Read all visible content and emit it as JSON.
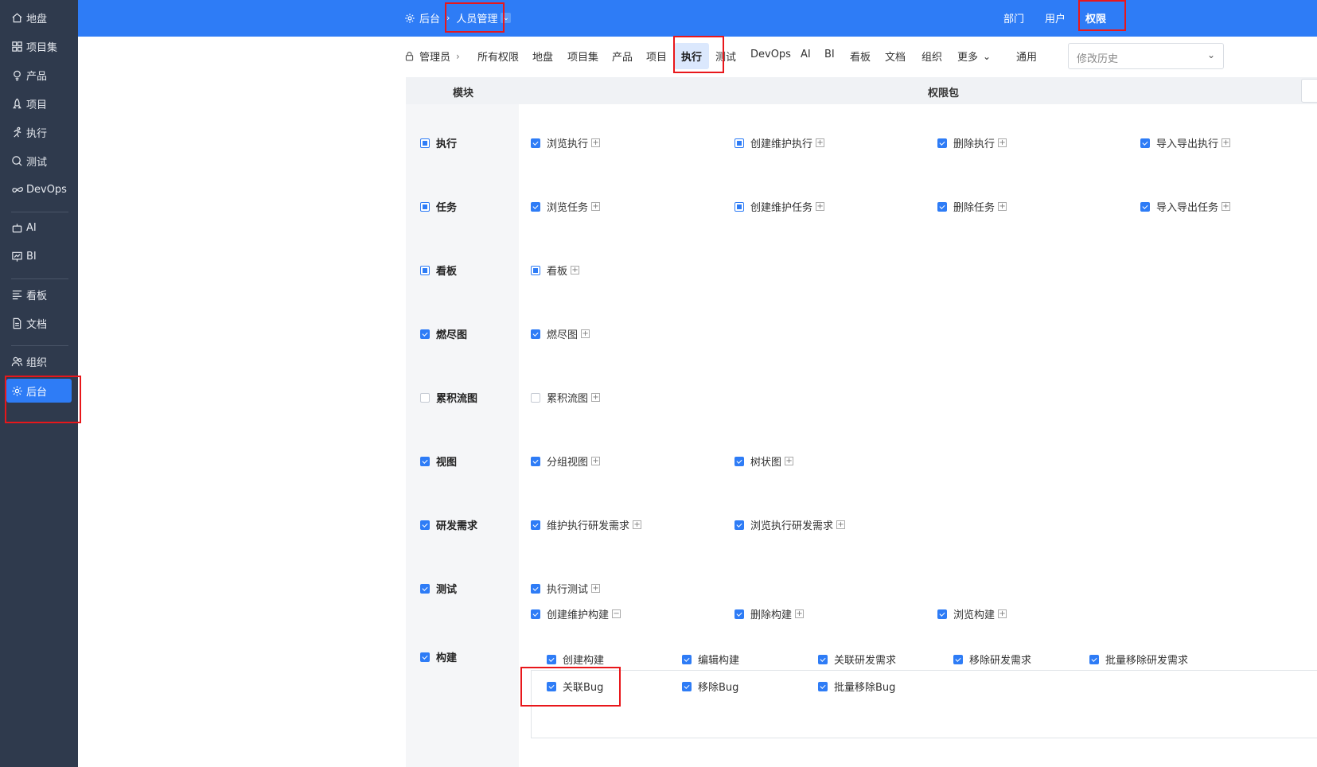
{
  "sidebar": {
    "items": [
      {
        "label": "地盘",
        "icon": "home-icon"
      },
      {
        "label": "项目集",
        "icon": "grid-icon"
      },
      {
        "label": "产品",
        "icon": "lightbulb-icon"
      },
      {
        "label": "项目",
        "icon": "rocket-icon"
      },
      {
        "label": "执行",
        "icon": "run-icon"
      },
      {
        "label": "测试",
        "icon": "test-search-icon"
      },
      {
        "label": "DevOps",
        "icon": "infinity-icon"
      },
      {
        "label": "AI",
        "icon": "robot-icon"
      },
      {
        "label": "BI",
        "icon": "chart-board-icon"
      },
      {
        "label": "看板",
        "icon": "kanban-icon"
      },
      {
        "label": "文档",
        "icon": "document-icon"
      },
      {
        "label": "组织",
        "icon": "people-icon"
      },
      {
        "label": "后台",
        "icon": "gear-icon",
        "active": true
      }
    ]
  },
  "topbar": {
    "root": "后台",
    "current": "人员管理",
    "nav": [
      "部门",
      "用户",
      "权限"
    ],
    "active_nav": "权限"
  },
  "subnav": {
    "role": "管理员",
    "tabs": [
      "所有权限",
      "地盘",
      "项目集",
      "产品",
      "项目",
      "执行",
      "测试",
      "DevOps",
      "AI",
      "BI",
      "看板",
      "文档",
      "组织",
      "更多",
      "通用"
    ],
    "active_tab": "执行",
    "history_placeholder": "修改历史"
  },
  "table": {
    "col_module": "模块",
    "col_packages": "权限包",
    "rows": [
      {
        "module": "执行",
        "state": "partial",
        "perms": [
          {
            "label": "浏览执行",
            "state": "checked",
            "toggle": "+"
          },
          {
            "label": "创建维护执行",
            "state": "partial",
            "toggle": "+"
          },
          {
            "label": "删除执行",
            "state": "checked",
            "toggle": "+"
          },
          {
            "label": "导入导出执行",
            "state": "checked",
            "toggle": "+"
          }
        ]
      },
      {
        "module": "任务",
        "state": "partial",
        "perms": [
          {
            "label": "浏览任务",
            "state": "checked",
            "toggle": "+"
          },
          {
            "label": "创建维护任务",
            "state": "partial",
            "toggle": "+"
          },
          {
            "label": "删除任务",
            "state": "checked",
            "toggle": "+"
          },
          {
            "label": "导入导出任务",
            "state": "checked",
            "toggle": "+"
          }
        ]
      },
      {
        "module": "看板",
        "state": "partial",
        "perms": [
          {
            "label": "看板",
            "state": "partial",
            "toggle": "+"
          }
        ]
      },
      {
        "module": "燃尽图",
        "state": "checked",
        "perms": [
          {
            "label": "燃尽图",
            "state": "checked",
            "toggle": "+"
          }
        ]
      },
      {
        "module": "累积流图",
        "state": "unchecked",
        "perms": [
          {
            "label": "累积流图",
            "state": "unchecked",
            "toggle": "+"
          }
        ]
      },
      {
        "module": "视图",
        "state": "checked",
        "perms": [
          {
            "label": "分组视图",
            "state": "checked",
            "toggle": "+"
          },
          {
            "label": "树状图",
            "state": "checked",
            "toggle": "+"
          }
        ]
      },
      {
        "module": "研发需求",
        "state": "checked",
        "perms": [
          {
            "label": "维护执行研发需求",
            "state": "checked",
            "toggle": "+"
          },
          {
            "label": "浏览执行研发需求",
            "state": "checked",
            "toggle": "+"
          }
        ]
      },
      {
        "module": "测试",
        "state": "checked",
        "perms": [
          {
            "label": "执行测试",
            "state": "checked",
            "toggle": "+"
          }
        ]
      },
      {
        "module": "构建",
        "state": "checked",
        "perms": [
          {
            "label": "创建维护构建",
            "state": "checked",
            "toggle": "−"
          },
          {
            "label": "删除构建",
            "state": "checked",
            "toggle": "+"
          },
          {
            "label": "浏览构建",
            "state": "checked",
            "toggle": "+"
          }
        ]
      }
    ],
    "sub_permissions": [
      "创建构建",
      "编辑构建",
      "关联研发需求",
      "移除研发需求",
      "批量移除研发需求",
      "关联Bug",
      "移除Bug",
      "批量移除Bug"
    ]
  },
  "colors": {
    "primary": "#2e7cf6",
    "sidebar_bg": "#2f3a4d",
    "highlight_red": "#e8171b"
  }
}
